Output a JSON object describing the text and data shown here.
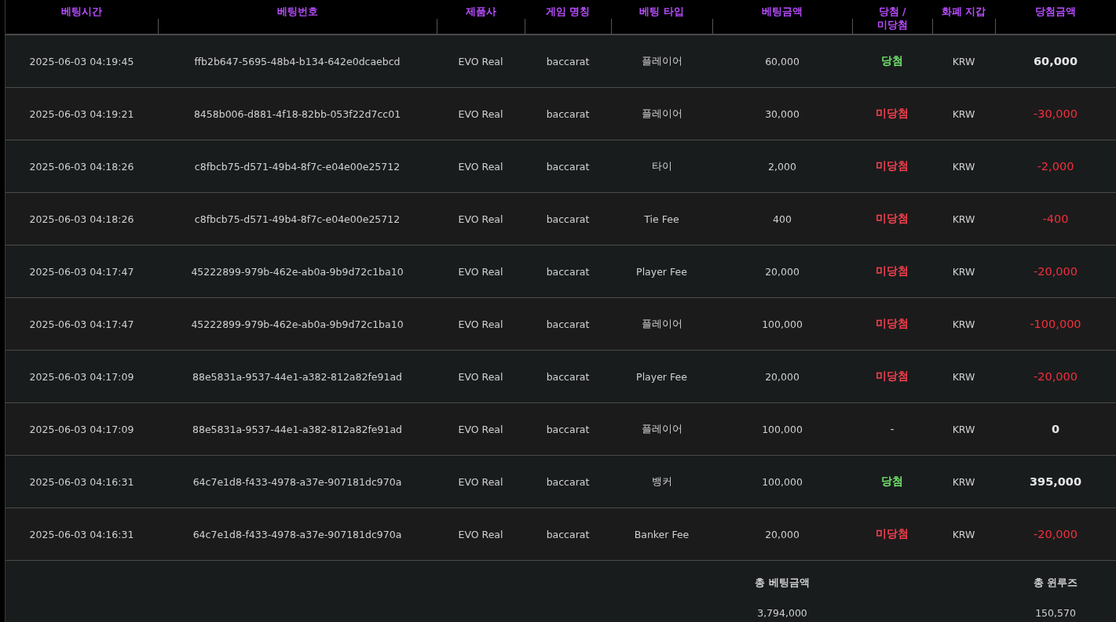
{
  "table": {
    "columns": [
      "베팅시간",
      "베팅번호",
      "제품사",
      "게임 명칭",
      "베팅 타입",
      "베팅금액",
      "당첨 / 미당첨",
      "화폐 지갑",
      "당첨금액"
    ],
    "rows": [
      {
        "time": "2025-06-03 04:19:45",
        "bet_id": "ffb2b647-5695-48b4-b134-642e0dcaebcd",
        "provider": "EVO Real",
        "game": "baccarat",
        "bet_type": "플레이어",
        "amount": "60,000",
        "result": "당첨",
        "kind": "win",
        "currency": "KRW",
        "payout": "60,000"
      },
      {
        "time": "2025-06-03 04:19:21",
        "bet_id": "8458b006-d881-4f18-82bb-053f22d7cc01",
        "provider": "EVO Real",
        "game": "baccarat",
        "bet_type": "플레이어",
        "amount": "30,000",
        "result": "미당첨",
        "kind": "lose",
        "currency": "KRW",
        "payout": "-30,000"
      },
      {
        "time": "2025-06-03 04:18:26",
        "bet_id": "c8fbcb75-d571-49b4-8f7c-e04e00e25712",
        "provider": "EVO Real",
        "game": "baccarat",
        "bet_type": "타이",
        "amount": "2,000",
        "result": "미당첨",
        "kind": "lose",
        "currency": "KRW",
        "payout": "-2,000"
      },
      {
        "time": "2025-06-03 04:18:26",
        "bet_id": "c8fbcb75-d571-49b4-8f7c-e04e00e25712",
        "provider": "EVO Real",
        "game": "baccarat",
        "bet_type": "Tie Fee",
        "amount": "400",
        "result": "미당첨",
        "kind": "lose",
        "currency": "KRW",
        "payout": "-400"
      },
      {
        "time": "2025-06-03 04:17:47",
        "bet_id": "45222899-979b-462e-ab0a-9b9d72c1ba10",
        "provider": "EVO Real",
        "game": "baccarat",
        "bet_type": "Player Fee",
        "amount": "20,000",
        "result": "미당첨",
        "kind": "lose",
        "currency": "KRW",
        "payout": "-20,000"
      },
      {
        "time": "2025-06-03 04:17:47",
        "bet_id": "45222899-979b-462e-ab0a-9b9d72c1ba10",
        "provider": "EVO Real",
        "game": "baccarat",
        "bet_type": "플레이어",
        "amount": "100,000",
        "result": "미당첨",
        "kind": "lose",
        "currency": "KRW",
        "payout": "-100,000"
      },
      {
        "time": "2025-06-03 04:17:09",
        "bet_id": "88e5831a-9537-44e1-a382-812a82fe91ad",
        "provider": "EVO Real",
        "game": "baccarat",
        "bet_type": "Player Fee",
        "amount": "20,000",
        "result": "미당첨",
        "kind": "lose",
        "currency": "KRW",
        "payout": "-20,000"
      },
      {
        "time": "2025-06-03 04:17:09",
        "bet_id": "88e5831a-9537-44e1-a382-812a82fe91ad",
        "provider": "EVO Real",
        "game": "baccarat",
        "bet_type": "플레이어",
        "amount": "100,000",
        "result": "-",
        "kind": "none",
        "currency": "KRW",
        "payout": "0"
      },
      {
        "time": "2025-06-03 04:16:31",
        "bet_id": "64c7e1d8-f433-4978-a37e-907181dc970a",
        "provider": "EVO Real",
        "game": "baccarat",
        "bet_type": "뱅커",
        "amount": "100,000",
        "result": "당첨",
        "kind": "win",
        "currency": "KRW",
        "payout": "395,000"
      },
      {
        "time": "2025-06-03 04:16:31",
        "bet_id": "64c7e1d8-f433-4978-a37e-907181dc970a",
        "provider": "EVO Real",
        "game": "baccarat",
        "bet_type": "Banker Fee",
        "amount": "20,000",
        "result": "미당첨",
        "kind": "lose",
        "currency": "KRW",
        "payout": "-20,000"
      }
    ]
  },
  "totals": {
    "bet_label": "총 베팅금액",
    "bet_value": "3,794,000",
    "winloss_label": "총 윈루즈",
    "winloss_value": "150,570"
  }
}
